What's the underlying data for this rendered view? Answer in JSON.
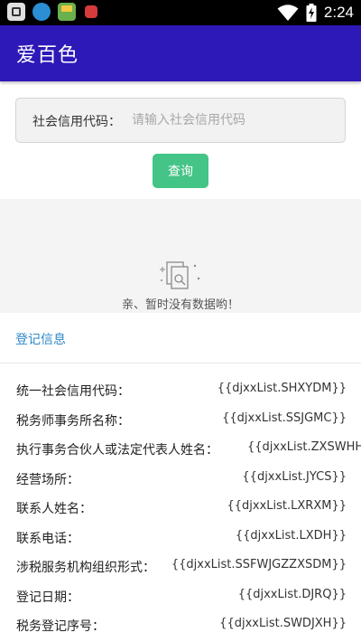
{
  "status_bar": {
    "time": "2:24",
    "notification_icons": [
      "app-icon",
      "browser-icon",
      "shop-bag-icon",
      "red-app-icon"
    ],
    "system_icons": [
      "wifi-icon",
      "battery-charging-icon"
    ]
  },
  "app_bar": {
    "title": "爱百色"
  },
  "search": {
    "label": "社会信用代码：",
    "value": "",
    "placeholder": "请输入社会信用代码"
  },
  "query_button": {
    "label": "查询"
  },
  "empty_state": {
    "text": "亲、暂时没有数据哟！",
    "icon": "document-search-icon"
  },
  "section": {
    "title": "登记信息"
  },
  "info_rows": [
    {
      "label": "统一社会信用代码：",
      "value": "{{djxxList.SHXYDM}}"
    },
    {
      "label": "税务师事务所名称：",
      "value": "{{djxxList.SSJGMC}}"
    },
    {
      "label": "执行事务合伙人或法定代表人姓名：",
      "value": "{{djxxList.ZXSWHH"
    },
    {
      "label": "经营场所：",
      "value": "{{djxxList.JYCS}}"
    },
    {
      "label": "联系人姓名：",
      "value": "{{djxxList.LXRXM}}"
    },
    {
      "label": "联系电话：",
      "value": "{{djxxList.LXDH}}"
    },
    {
      "label": "涉税服务机构组织形式：",
      "value": "{{djxxList.SSFWJGZZXSDM}}"
    },
    {
      "label": "登记日期：",
      "value": "{{djxxList.DJRQ}}"
    },
    {
      "label": "税务登记序号：",
      "value": "{{djxxList.SWDJXH}}"
    }
  ],
  "colors": {
    "app_bar": "#2d18b8",
    "button": "#44c486",
    "section_title": "#2e88c7"
  }
}
